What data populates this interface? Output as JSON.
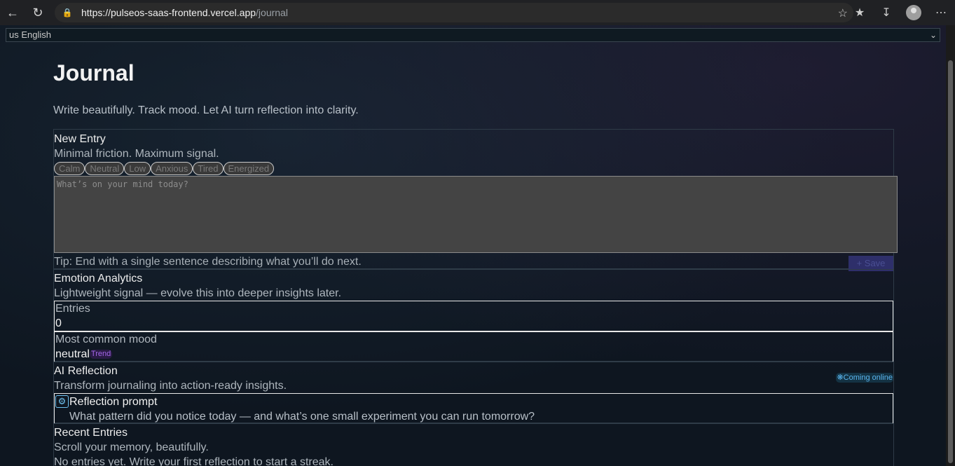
{
  "browser": {
    "url_host": "https://pulseos-saas-frontend.vercel.app",
    "url_path": "/journal"
  },
  "language": {
    "selected": "us English"
  },
  "page": {
    "title": "Journal",
    "subtitle": "Write beautifully. Track mood. Let AI turn reflection into clarity."
  },
  "new_entry": {
    "title": "New Entry",
    "subtitle": "Minimal friction. Maximum signal.",
    "moods": [
      "Calm",
      "Neutral",
      "Low",
      "Anxious",
      "Tired",
      "Energized"
    ],
    "placeholder": "What’s on your mind today?",
    "tip": "Tip: End with a single sentence describing what you’ll do next.",
    "save_label": "+ Save"
  },
  "analytics": {
    "title": "Emotion Analytics",
    "subtitle": "Lightweight signal — evolve this into deeper insights later.",
    "entries_label": "Entries",
    "entries_value": "0",
    "mood_label": "Most common mood",
    "mood_value": "neutral",
    "trend_badge": "Trend"
  },
  "ai_reflection": {
    "title": "AI Reflection",
    "subtitle": "Transform journaling into action-ready insights.",
    "badge": "Coming online",
    "prompt_title": "Reflection prompt",
    "prompt_text": "What pattern did you notice today — and what’s one small experiment you can run tomorrow?"
  },
  "recent": {
    "title": "Recent Entries",
    "subtitle": "Scroll your memory, beautifully.",
    "empty": "No entries yet. Write your first reflection to start a streak."
  },
  "icons": [
    "back-icon",
    "reload-icon",
    "lock-icon",
    "star-icon",
    "favorites-icon",
    "download-icon",
    "profile-icon",
    "more-icon",
    "chevron-down-icon",
    "brain-icon",
    "sparkle-icon"
  ]
}
